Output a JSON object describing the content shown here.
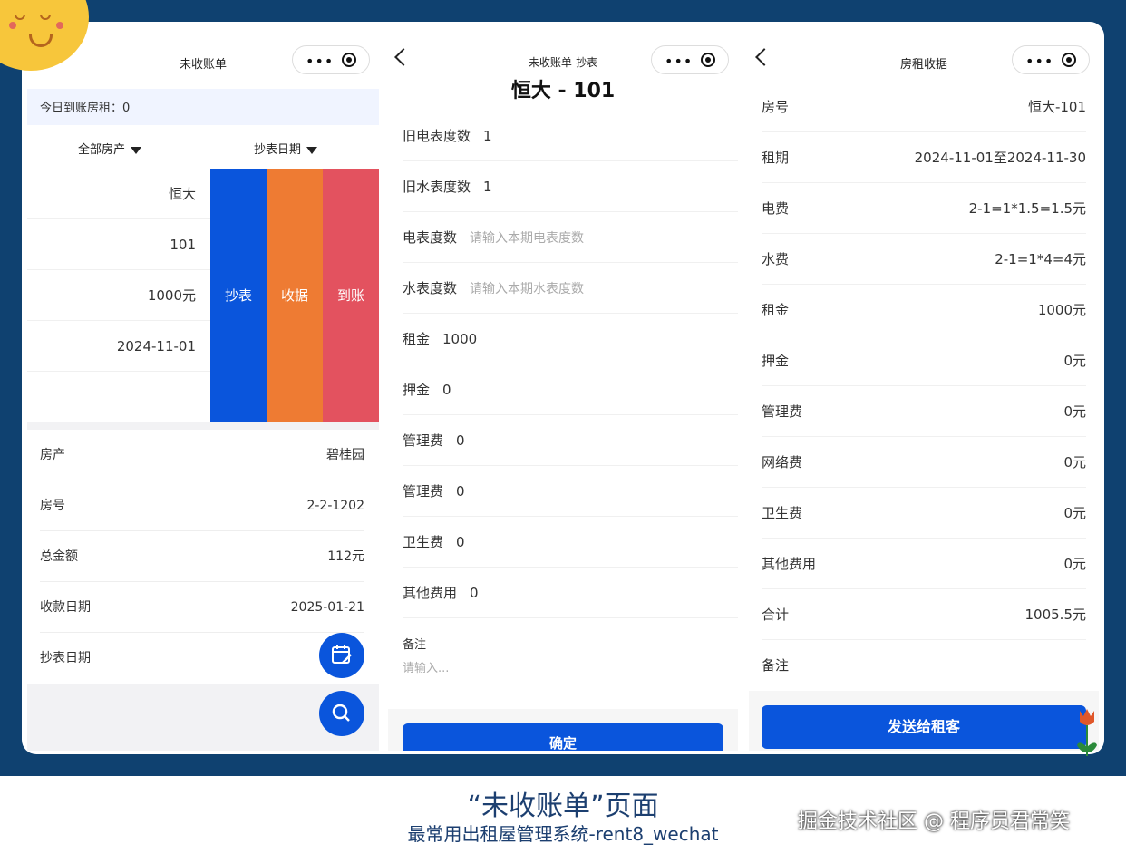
{
  "colors": {
    "background": "#0f4170",
    "primary": "#0a55dc",
    "orange": "#ee7b33",
    "red": "#e3525f"
  },
  "phone1": {
    "title": "未收账单",
    "today_label": "今日到账房租：0",
    "filters": [
      "全部房产",
      "抄表日期"
    ],
    "card_rows": [
      "恒大",
      "101",
      "1000元",
      "2024-11-01"
    ],
    "actions": [
      "抄表",
      "收据",
      "到账"
    ],
    "list": [
      {
        "label": "房产",
        "value": "碧桂园"
      },
      {
        "label": "房号",
        "value": "2-2-1202"
      },
      {
        "label": "总金额",
        "value": "112元"
      },
      {
        "label": "收款日期",
        "value": "2025-01-21"
      },
      {
        "label": "抄表日期",
        "value": ""
      }
    ]
  },
  "phone2": {
    "title": "未收账单-抄表",
    "subtitle": "恒大 - 101",
    "fields": [
      {
        "label": "旧电表度数",
        "value": "1",
        "placeholder": ""
      },
      {
        "label": "旧水表度数",
        "value": "1",
        "placeholder": ""
      },
      {
        "label": "电表度数",
        "value": "",
        "placeholder": "请输入本期电表度数"
      },
      {
        "label": "水表度数",
        "value": "",
        "placeholder": "请输入本期水表度数"
      },
      {
        "label": "租金",
        "value": "1000",
        "placeholder": ""
      },
      {
        "label": "押金",
        "value": "0",
        "placeholder": ""
      },
      {
        "label": "管理费",
        "value": "0",
        "placeholder": ""
      },
      {
        "label": "管理费",
        "value": "0",
        "placeholder": ""
      },
      {
        "label": "卫生费",
        "value": "0",
        "placeholder": ""
      },
      {
        "label": "其他费用",
        "value": "0",
        "placeholder": ""
      }
    ],
    "note_label": "备注",
    "note_placeholder": "请输入...",
    "confirm": "确定"
  },
  "phone3": {
    "title": "房租收据",
    "rows": [
      {
        "label": "房号",
        "value": "恒大-101"
      },
      {
        "label": "租期",
        "value": "2024-11-01至2024-11-30"
      },
      {
        "label": "电费",
        "value": "2-1=1*1.5=1.5元"
      },
      {
        "label": "水费",
        "value": "2-1=1*4=4元"
      },
      {
        "label": "租金",
        "value": "1000元"
      },
      {
        "label": "押金",
        "value": "0元"
      },
      {
        "label": "管理费",
        "value": "0元"
      },
      {
        "label": "网络费",
        "value": "0元"
      },
      {
        "label": "卫生费",
        "value": "0元"
      },
      {
        "label": "其他费用",
        "value": "0元"
      },
      {
        "label": "合计",
        "value": "1005.5元"
      },
      {
        "label": "备注",
        "value": ""
      }
    ],
    "send": "发送给租客"
  },
  "caption": {
    "title": "“未收账单”页面",
    "subtitle": "最常用出租屋管理系统-rent8_wechat",
    "watermark": "掘金技术社区 @ 程序员君常笑"
  }
}
